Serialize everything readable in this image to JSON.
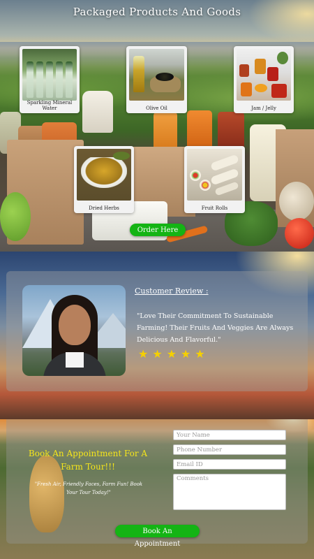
{
  "products_section": {
    "title": "Packaged Products And Goods",
    "order_button": "Order Here",
    "products": [
      {
        "label": "Sparkling Mineral Water",
        "image": "sparkling-water-bottles-image"
      },
      {
        "label": "Olive Oil",
        "image": "olive-oil-image"
      },
      {
        "label": "Jam / Jelly",
        "image": "jam-jars-image"
      },
      {
        "label": "Dried Herbs",
        "image": "dried-herbs-image"
      },
      {
        "label": "Fruit Rolls",
        "image": "fruit-rolls-image"
      }
    ]
  },
  "review_section": {
    "heading": "Customer Review :",
    "quote": "\"Love Their Commitment To Sustainable Farming! Their Fruits And Veggies Are Always Delicious And Flavorful.\"",
    "rating": 5,
    "stars": "★★★★★",
    "star_color": "#f5d000"
  },
  "appointment_section": {
    "title": "Book An Appointment For A Farm Tour!!!",
    "subtitle": "\"Fresh Air, Friendly Faces, Farm Fun! Book Your Tour Today!\"",
    "fields": {
      "name_placeholder": "Your Name",
      "phone_placeholder": "Phone Number",
      "email_placeholder": "Email ID",
      "comments_placeholder": "Comments"
    },
    "submit_button": "Book An Appointment"
  },
  "colors": {
    "button_green": "#14b414",
    "title_yellow": "#f5e51b"
  }
}
